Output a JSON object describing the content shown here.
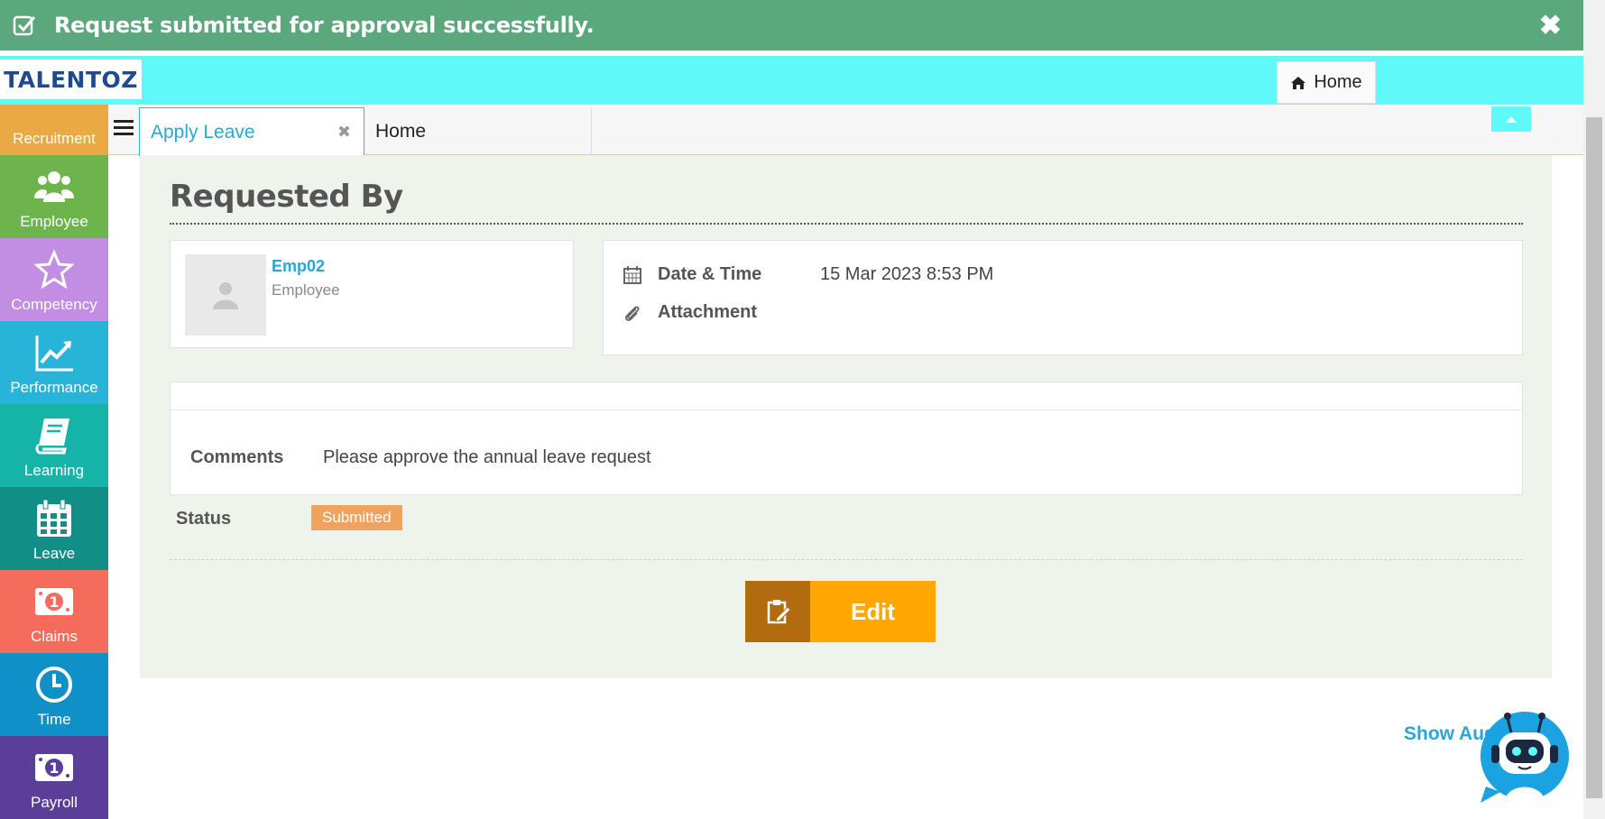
{
  "banner": {
    "message": "Request submitted for approval successfully."
  },
  "header": {
    "logo": "TALENTOZ",
    "home_label": "Home"
  },
  "sidebar": {
    "items": [
      {
        "label": "Recruitment",
        "color": "#e9a945",
        "icon": "briefcase-icon"
      },
      {
        "label": "Employee",
        "color": "#6cb44b",
        "icon": "users-icon"
      },
      {
        "label": "Competency",
        "color": "#c18ee3",
        "icon": "star-icon"
      },
      {
        "label": "Performance",
        "color": "#28b3d9",
        "icon": "chart-icon"
      },
      {
        "label": "Learning",
        "color": "#16b3a8",
        "icon": "book-icon"
      },
      {
        "label": "Leave",
        "color": "#118e85",
        "icon": "calendar-icon"
      },
      {
        "label": "Claims",
        "color": "#f56c5c",
        "icon": "money-icon"
      },
      {
        "label": "Time",
        "color": "#0f91c7",
        "icon": "clock-icon"
      },
      {
        "label": "Payroll",
        "color": "#5a3e97",
        "icon": "money-icon"
      }
    ]
  },
  "tabs": {
    "active": "Apply Leave",
    "second": "Home"
  },
  "request": {
    "title": "Requested By",
    "employee_name": "Emp02",
    "employee_role": "Employee",
    "datetime_label": "Date & Time",
    "datetime_value": "15 Mar 2023 8:53 PM",
    "attachment_label": "Attachment",
    "comments_label": "Comments",
    "comments_value": "Please approve the annual leave request",
    "status_label": "Status",
    "status_value": "Submitted",
    "edit_label": "Edit"
  },
  "footer": {
    "audit_label": "Show Audit"
  },
  "colors": {
    "banner": "#5ba87d",
    "topbar": "#5ff9f9",
    "accent": "#29a6d8",
    "edit": "#ffa600",
    "status": "#f0a35e"
  }
}
